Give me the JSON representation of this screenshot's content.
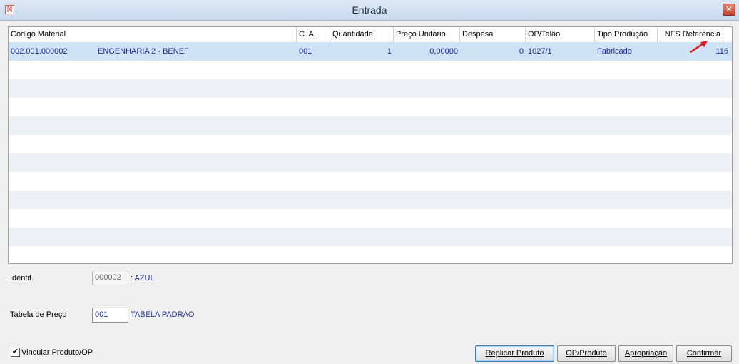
{
  "window": {
    "title": "Entrada",
    "app_icon": "app-logo-icon",
    "close_glyph": "✕"
  },
  "grid": {
    "columns": [
      "Código Material",
      "C. A.",
      "Quantidade",
      "Preço Unitário",
      "Despesa",
      "OP/Talão",
      "Tipo Produção",
      "NFS Referência"
    ],
    "rows": [
      {
        "codigo": "002.001.000002",
        "descricao": "ENGENHARIA 2 - BENEF",
        "ca": "001",
        "quantidade": "1",
        "preco_unitario": "0,00000",
        "despesa": "0",
        "op_talao": "1027/1",
        "tipo_producao": "Fabricado",
        "nfs_referencia": "116"
      }
    ],
    "selected_row_color": "#cfe3f7",
    "alt_row_color": "#edf1f6"
  },
  "annotation": {
    "icon": "red-arrow-icon",
    "color": "#e8141c"
  },
  "form": {
    "identif": {
      "label": "Identif.",
      "value": "000002",
      "description": ": AZUL"
    },
    "tabela_preco": {
      "label": "Tabela de Preço",
      "value": "001",
      "description": "TABELA PADRAO"
    },
    "vincular": {
      "label": "Vincular Produto/OP",
      "checked": true,
      "check_glyph": "✔"
    }
  },
  "buttons": {
    "replicar": "Replicar Produto",
    "op_produto": "OP/Produto",
    "apropriacao": "Apropriação",
    "confirmar": "Confirmar"
  }
}
